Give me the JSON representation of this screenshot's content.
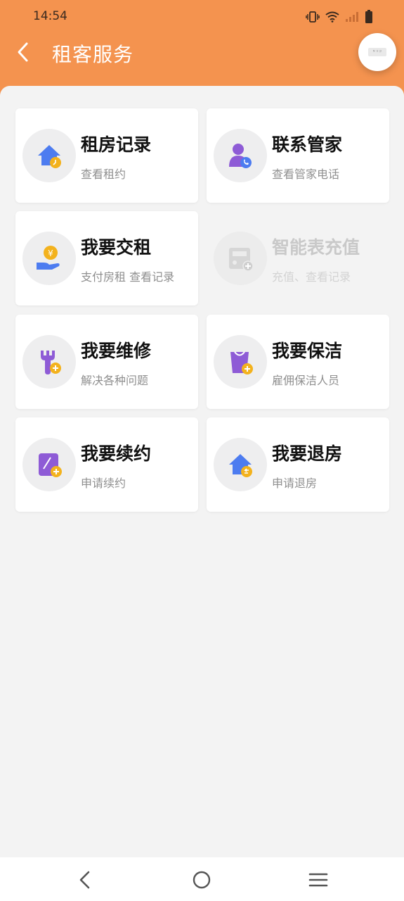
{
  "status_bar": {
    "time": "14:54"
  },
  "header": {
    "title": "租客服务",
    "float_button_label": "ᶰᵘᵖ"
  },
  "colors": {
    "accent": "#f4934f",
    "icon_purple": "#8e5bd6",
    "icon_blue": "#4d7cf0",
    "icon_yellow": "#f3b21d"
  },
  "services": [
    {
      "title": "租房记录",
      "subtitle": "查看租约",
      "icon": "house-clock-icon"
    },
    {
      "title": "联系管家",
      "subtitle": "查看管家电话",
      "icon": "person-phone-icon"
    },
    {
      "title": "我要交租",
      "subtitle": "支付房租 查看记录",
      "icon": "hand-coin-icon"
    },
    {
      "title": "智能表充值",
      "subtitle": "充值、查看记录",
      "icon": "meter-plus-icon",
      "disabled": true
    },
    {
      "title": "我要维修",
      "subtitle": "解决各种问题",
      "icon": "wrench-plus-icon"
    },
    {
      "title": "我要保洁",
      "subtitle": "雇佣保洁人员",
      "icon": "bag-plus-icon"
    },
    {
      "title": "我要续约",
      "subtitle": "申请续约",
      "icon": "document-plus-icon"
    },
    {
      "title": "我要退房",
      "subtitle": "申请退房",
      "icon": "house-return-icon"
    }
  ]
}
